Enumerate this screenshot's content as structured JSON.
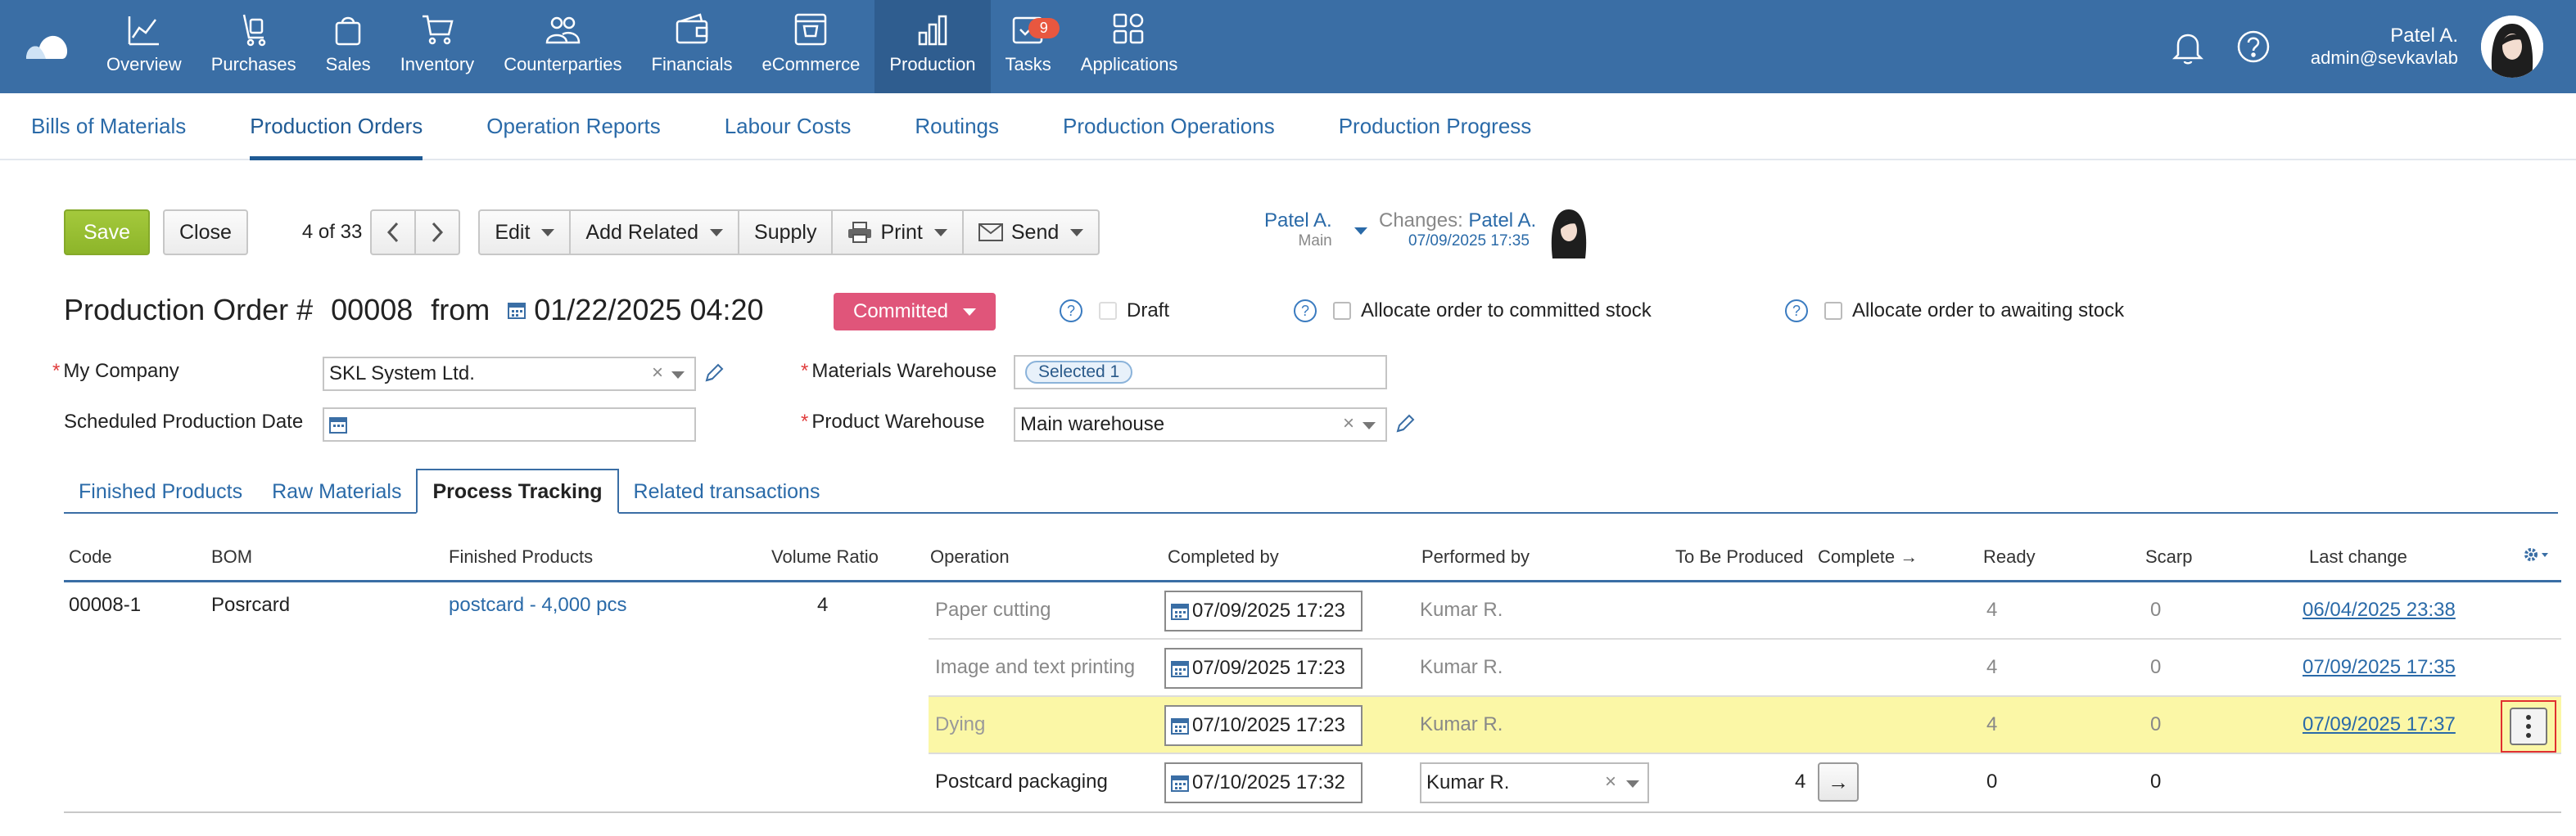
{
  "nav": {
    "items": [
      {
        "label": "Overview",
        "icon": "overview-icon"
      },
      {
        "label": "Purchases",
        "icon": "purchases-icon"
      },
      {
        "label": "Sales",
        "icon": "sales-icon"
      },
      {
        "label": "Inventory",
        "icon": "inventory-icon"
      },
      {
        "label": "Counterparties",
        "icon": "counterparties-icon"
      },
      {
        "label": "Financials",
        "icon": "financials-icon"
      },
      {
        "label": "eCommerce",
        "icon": "ecommerce-icon"
      },
      {
        "label": "Production",
        "icon": "production-icon"
      },
      {
        "label": "Tasks",
        "icon": "tasks-icon",
        "badge": "9"
      },
      {
        "label": "Applications",
        "icon": "applications-icon"
      }
    ],
    "active": "Production"
  },
  "user": {
    "name": "Patel A.",
    "email": "admin@sevkavlab"
  },
  "subnav": {
    "items": [
      "Bills of Materials",
      "Production Orders",
      "Operation Reports",
      "Labour Costs",
      "Routings",
      "Production Operations",
      "Production Progress"
    ],
    "active": "Production Orders"
  },
  "toolbar": {
    "save": "Save",
    "close": "Close",
    "pager": "4 of 33",
    "edit": "Edit",
    "add_related": "Add Related",
    "supply": "Supply",
    "print": "Print",
    "send": "Send"
  },
  "owner": {
    "name": "Patel A.",
    "sub": "Main"
  },
  "changes": {
    "label": "Changes:",
    "name": "Patel A.",
    "date": "07/09/2025 17:35"
  },
  "order": {
    "title": "Production Order #",
    "number": "00008",
    "from": "from",
    "date": "01/22/2025 04:20",
    "status": "Committed",
    "draft": "Draft",
    "allocate_committed": "Allocate order to committed stock",
    "allocate_awaiting": "Allocate order to awaiting stock"
  },
  "form": {
    "my_company_label": "My Company",
    "my_company_value": "SKL System Ltd.",
    "scheduled_label": "Scheduled Production Date",
    "materials_wh_label": "Materials Warehouse",
    "materials_wh_tag": "Selected 1",
    "product_wh_label": "Product Warehouse",
    "product_wh_value": "Main warehouse"
  },
  "tabs": {
    "items": [
      "Finished Products",
      "Raw Materials",
      "Process Tracking",
      "Related transactions"
    ],
    "active": "Process Tracking"
  },
  "table": {
    "headers": {
      "code": "Code",
      "bom": "BOM",
      "finished": "Finished Products",
      "ratio": "Volume Ratio",
      "operation": "Operation",
      "completed_by": "Completed by",
      "performed_by": "Performed by",
      "to_be_produced": "To Be Produced",
      "complete": "Complete →",
      "ready": "Ready",
      "scarp": "Scarp",
      "last_change": "Last change"
    },
    "order_row": {
      "code": "00008-1",
      "bom": "Posrcard",
      "finished": "postcard - 4,000 pcs",
      "ratio": "4"
    },
    "operations": [
      {
        "operation": "Paper cutting",
        "completed_by": "07/09/2025 17:23",
        "performed_by": "Kumar R.",
        "to_be_produced": "",
        "ready": "4",
        "scarp": "0",
        "last_change": "06/04/2025 23:38"
      },
      {
        "operation": "Image and text printing",
        "completed_by": "07/09/2025 17:23",
        "performed_by": "Kumar R.",
        "to_be_produced": "",
        "ready": "4",
        "scarp": "0",
        "last_change": "07/09/2025 17:35"
      },
      {
        "operation": "Dying",
        "completed_by": "07/10/2025 17:23",
        "performed_by": "Kumar R.",
        "to_be_produced": "",
        "ready": "4",
        "scarp": "0",
        "last_change": "07/09/2025 17:37"
      },
      {
        "operation": "Postcard packaging",
        "completed_by": "07/10/2025 17:32",
        "performed_by": "Kumar R.",
        "to_be_produced": "4",
        "ready": "0",
        "scarp": "0",
        "last_change": ""
      }
    ],
    "complete_arrow": "→"
  },
  "colors": {
    "topbar": "#3a6ea5",
    "active_nav": "#2f5d8f",
    "link": "#2a6aa8",
    "save": "#97bf32",
    "status": "#e0557a",
    "highlight_row": "#fbf7a6",
    "focus_outline": "#e03030"
  }
}
